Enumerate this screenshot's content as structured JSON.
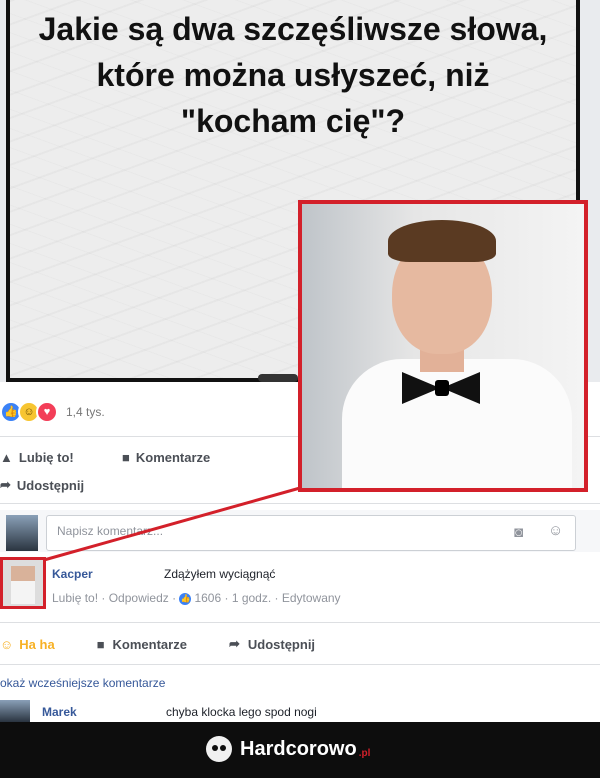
{
  "meme": {
    "question": "Jakie są dwa szczęśliwsze słowa, które można usłyszeć, niż \"kocham cię\"?"
  },
  "post": {
    "reaction_count": "1,4 tys.",
    "like_label": "Lubię to!",
    "comments_label": "Komentarze",
    "share_label": "Udostępnij"
  },
  "comment_box": {
    "placeholder": "Napisz komentarz..."
  },
  "comment_1": {
    "author": "Kacper",
    "text": "Zdążyłem wyciągnąć",
    "like": "Lubię to!",
    "reply": "Odpowiedz",
    "reactions": "1606",
    "time": "1 godz.",
    "edited": "Edytowany"
  },
  "actions_bottom": {
    "haha": "Ha ha",
    "comments": "Komentarze",
    "share": "Udostępnij"
  },
  "earlier_comments": "okaż wcześniejsze komentarze",
  "comment_2": {
    "author": "Marek",
    "text": "chyba klocka lego spod nogi"
  },
  "brand": {
    "name": "Hardcorowo",
    "suffix": ".pl"
  }
}
